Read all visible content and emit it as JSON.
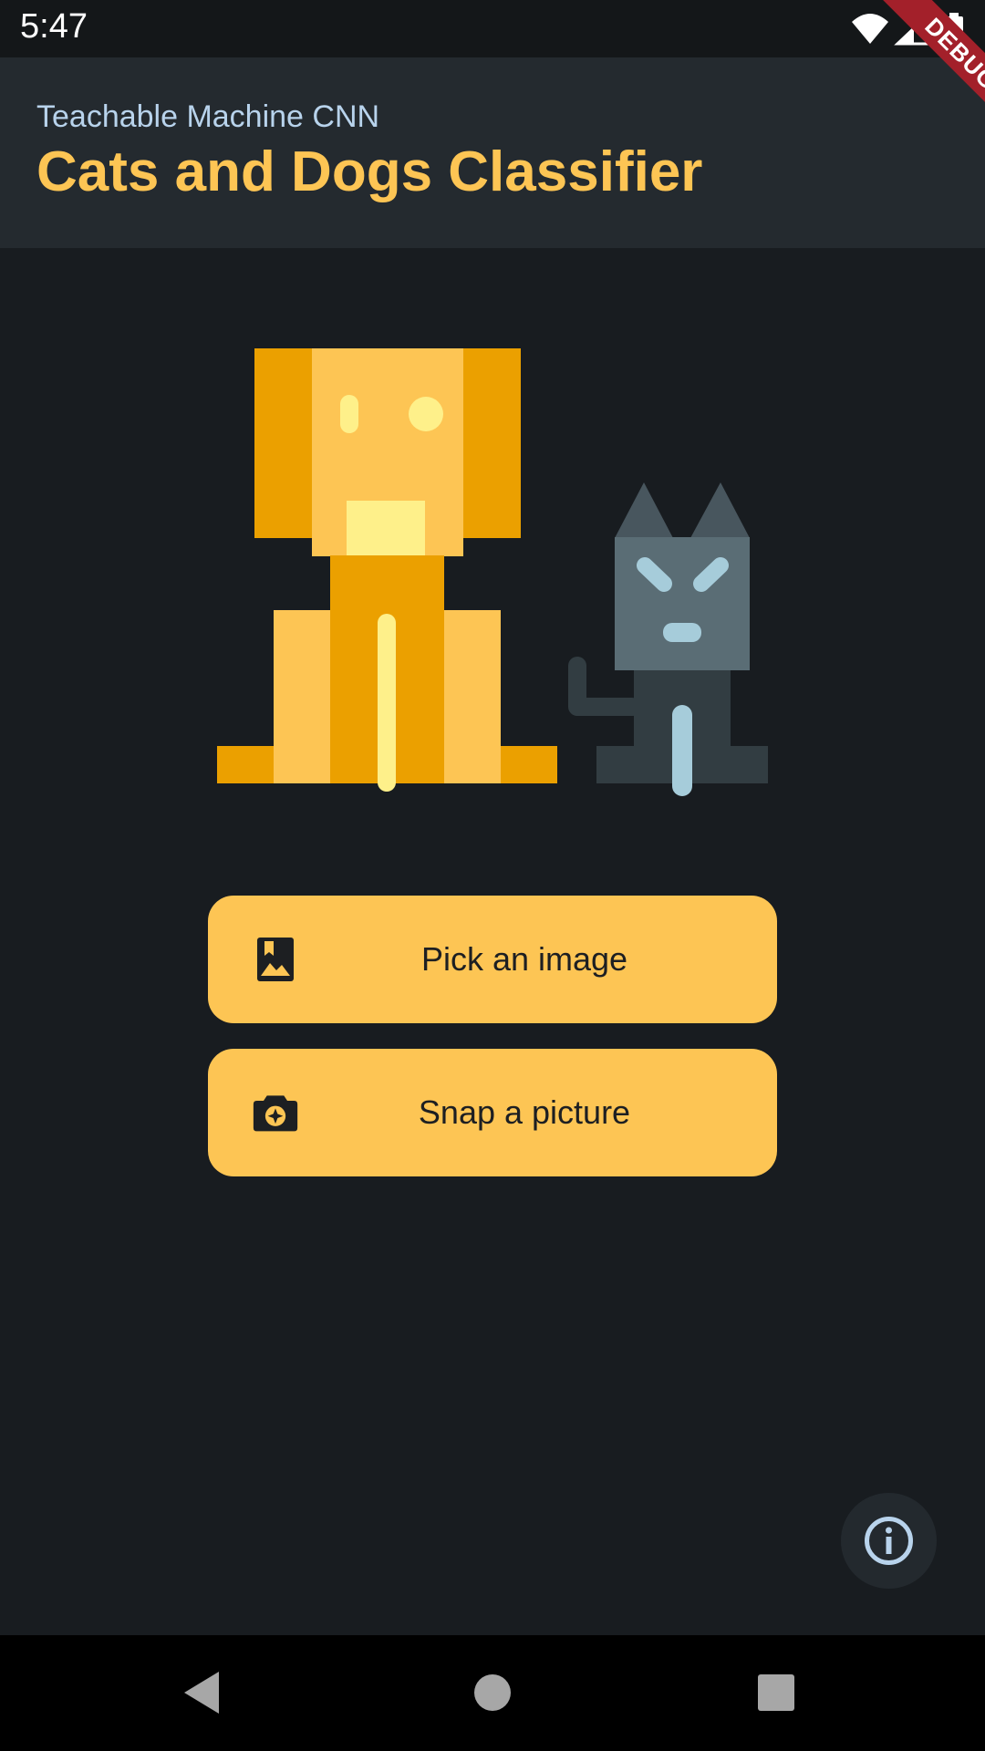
{
  "status_bar": {
    "time": "5:47",
    "icons": [
      "wifi-icon",
      "signal-icon",
      "battery-icon"
    ]
  },
  "debug_banner": {
    "label": "DEBUG"
  },
  "app_bar": {
    "subtitle": "Teachable Machine CNN",
    "title": "Cats and Dogs Classifier"
  },
  "actions": {
    "pick_image": {
      "label": "Pick an image",
      "icon": "photo-library-icon"
    },
    "snap_picture": {
      "label": "Snap a picture",
      "icon": "camera-icon"
    }
  },
  "fab": {
    "icon": "info-icon"
  },
  "nav": {
    "back": "back-icon",
    "home": "home-icon",
    "recents": "recents-icon"
  },
  "colors": {
    "background": "#181c20",
    "app_bar": "#242a2f",
    "accent": "#fdc554",
    "subtitle": "#b8d3ec",
    "debug": "#a3202a"
  }
}
